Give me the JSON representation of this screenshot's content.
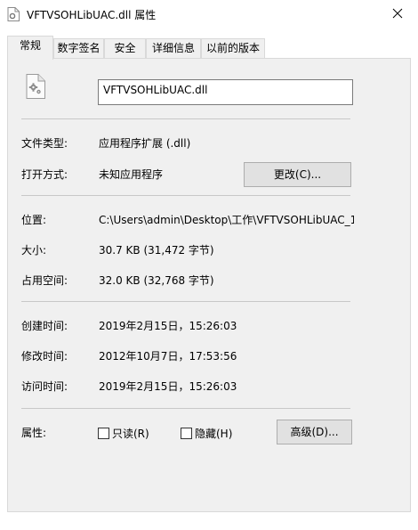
{
  "window": {
    "title": "VFTVSOHLibUAC.dll 属性",
    "file_icon": "dll-gear-file-icon",
    "close_icon": "close-icon"
  },
  "tabs": [
    {
      "label": "常规",
      "active": true
    },
    {
      "label": "数字签名",
      "active": false
    },
    {
      "label": "安全",
      "active": false
    },
    {
      "label": "详细信息",
      "active": false
    },
    {
      "label": "以前的版本",
      "active": false
    }
  ],
  "general": {
    "file_name": "VFTVSOHLibUAC.dll",
    "file_type_label": "文件类型:",
    "file_type_value": "应用程序扩展 (.dll)",
    "opens_with_label": "打开方式:",
    "opens_with_value": "未知应用程序",
    "change_button": "更改(C)...",
    "location_label": "位置:",
    "location_value": "C:\\Users\\admin\\Desktop\\工作\\VFTVSOHLibUAC_1",
    "size_label": "大小:",
    "size_value": "30.7 KB (31,472 字节)",
    "size_on_disk_label": "占用空间:",
    "size_on_disk_value": "32.0 KB (32,768 字节)",
    "created_label": "创建时间:",
    "created_value": "2019年2月15日，15:26:03",
    "modified_label": "修改时间:",
    "modified_value": "2012年10月7日，17:53:56",
    "accessed_label": "访问时间:",
    "accessed_value": "2019年2月15日，15:26:03",
    "attributes_label": "属性:",
    "readonly_label": "只读(R)",
    "readonly_checked": false,
    "hidden_label": "隐藏(H)",
    "hidden_checked": false,
    "advanced_button": "高级(D)..."
  },
  "colors": {
    "panel_bg": "#f0f0f0",
    "button_bg": "#e1e1e1",
    "border": "#adadad"
  }
}
